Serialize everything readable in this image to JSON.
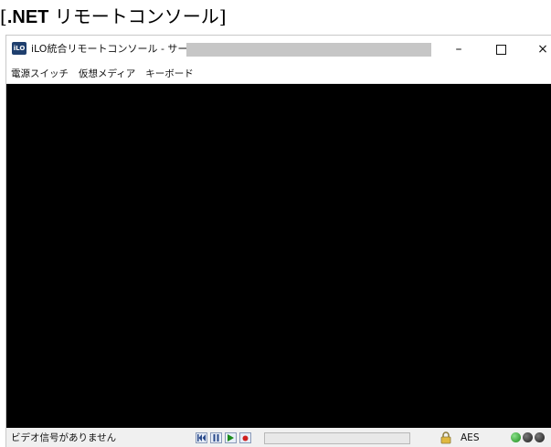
{
  "caption": {
    "open_bracket": "[",
    "net": ".NET",
    "title": " リモートコンソール",
    "close_bracket": "]"
  },
  "window": {
    "app_icon_text": "iLO",
    "title": "iLO統合リモートコンソール - サーバー:",
    "controls": {
      "minimize": "–",
      "close": "×"
    }
  },
  "menu": {
    "items": [
      "電源スイッチ",
      "仮想メディア",
      "キーボード"
    ]
  },
  "status": {
    "message": "ビデオ信号がありません",
    "progress": 0,
    "encryption": "AES",
    "indicators": [
      "green",
      "black",
      "black"
    ]
  },
  "colors": {
    "screen": "#000000",
    "indicator_on": "#22a022",
    "indicator_off": "#222222"
  }
}
